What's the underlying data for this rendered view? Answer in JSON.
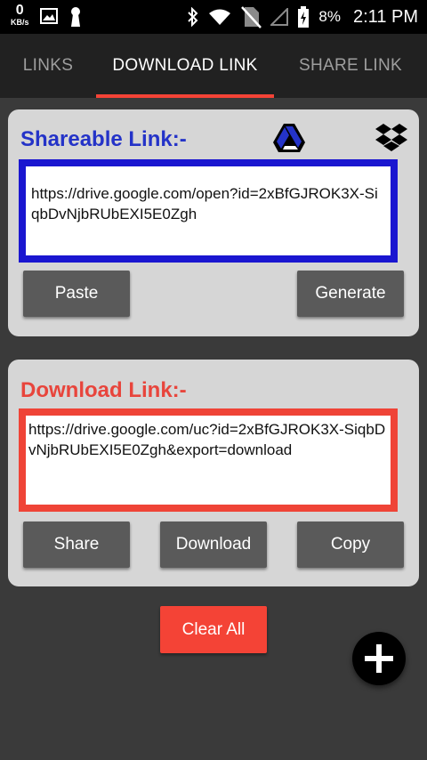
{
  "status_bar": {
    "net_speed": "0",
    "net_unit": "KB/s",
    "battery": "8%",
    "time": "2:11 PM"
  },
  "tabs": [
    {
      "label": "LINKS"
    },
    {
      "label": "DOWNLOAD LINK"
    },
    {
      "label": "SHARE LINK"
    }
  ],
  "active_tab": 1,
  "shareable": {
    "title": "Shareable Link:-",
    "url": "https://drive.google.com/open?id=2xBfGJROK3X-SiqbDvNjbRUbEXI5E0Zgh",
    "paste_label": "Paste",
    "generate_label": "Generate",
    "accent": "#1a16d0"
  },
  "download": {
    "title": "Download Link:-",
    "url": "https://drive.google.com/uc?id=2xBfGJROK3X-SiqbDvNjbRUbEXI5E0Zgh&export=download",
    "share_label": "Share",
    "download_label": "Download",
    "copy_label": "Copy",
    "accent": "#ef4437"
  },
  "clear_all_label": "Clear All",
  "icons": {
    "gdrive": "google-drive-icon",
    "dropbox": "dropbox-icon",
    "fab": "plus-icon"
  }
}
